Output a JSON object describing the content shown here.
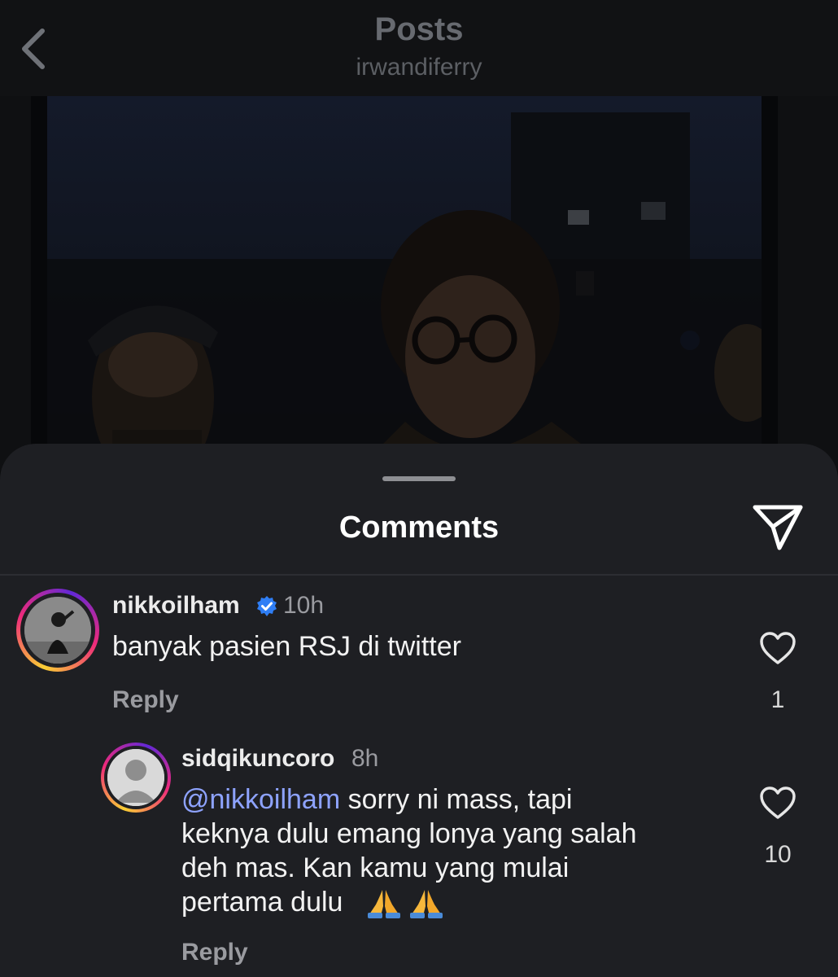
{
  "header": {
    "title": "Posts",
    "subtitle": "irwandiferry"
  },
  "sheet": {
    "title": "Comments"
  },
  "comments": [
    {
      "username": "nikkoilham",
      "verified": true,
      "time": "10h",
      "text": "banyak pasien RSJ di twitter",
      "reply_label": "Reply",
      "likes": "1"
    },
    {
      "username": "sidqikuncoro",
      "time": "8h",
      "mention": "@nikkoilham",
      "text_line1": " sorry ni mass, tapi",
      "text_line2": "keknya dulu emang lonya yang salah",
      "text_line3": "deh mas. Kan kamu yang mulai",
      "text_line4": "pertama dulu",
      "emoji": "folded-hands-emoji",
      "reply_label": "Reply",
      "likes": "10"
    }
  ],
  "colors": {
    "mention": "#8ea3ff",
    "verified": "#2f7ef5"
  }
}
